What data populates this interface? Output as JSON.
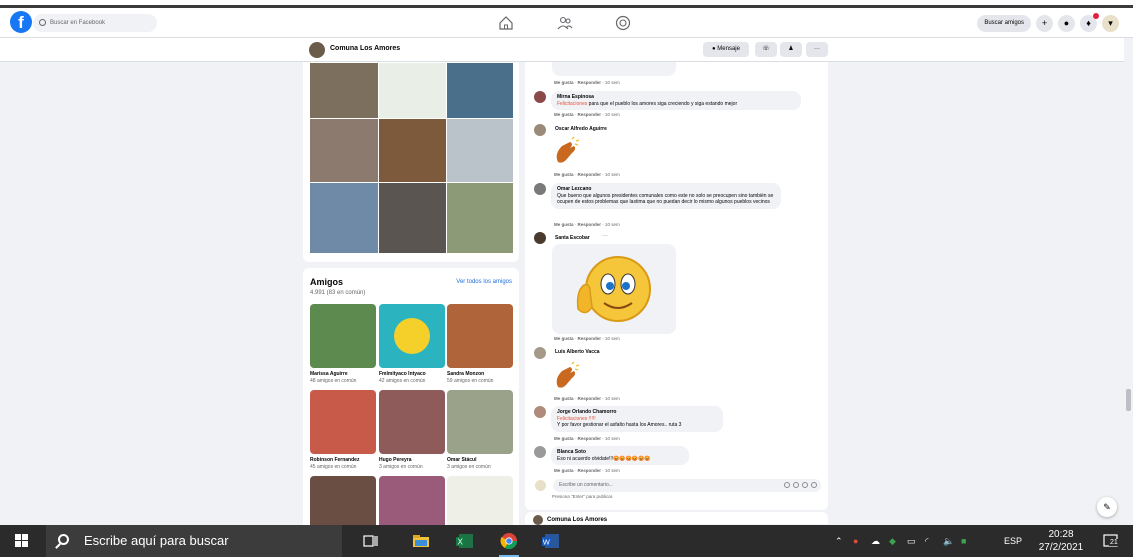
{
  "header": {
    "search_placeholder": "Buscar en Facebook",
    "find_friends": "Buscar amigos"
  },
  "page_bar": {
    "page_name": "Comuna Los Amores",
    "message_button": "Mensaje",
    "more_button": "···"
  },
  "friends": {
    "title": "Amigos",
    "count": "4.991 (83 en común)",
    "see_all": "Ver todos los amigos",
    "items": [
      {
        "name": "Marissa Aguirre",
        "mutual": "48 amigos en común"
      },
      {
        "name": "Fmlmityaco Intyaco",
        "mutual": "42 amigos en común"
      },
      {
        "name": "Sandra Monzon",
        "mutual": "59 amigos en común"
      },
      {
        "name": "Robinson Fernandez",
        "mutual": "45 amigos en común"
      },
      {
        "name": "Hugo Pereyra",
        "mutual": "3 amigos en común"
      },
      {
        "name": "Omar Stácul",
        "mutual": "3 amigos en común"
      }
    ]
  },
  "comments": {
    "like": "Me gusta",
    "reply": "Responder",
    "time": "10 sem",
    "items": [
      {
        "author": "Mirna Espinosa",
        "highlight": "Felicitaciones",
        "text": " para que el pueblo los amores siga creciendo y siga estando mejor"
      },
      {
        "author": "Oscar Alfredo Aguirre"
      },
      {
        "author": "Omar Lezcano",
        "text": "Que bueno que algunos presidentes comunales como este no solo se preocupen sino también se ocupen de estos problemas que lastima que no puedan decir lo mismo algunos pueblos vecinos"
      },
      {
        "author": "Santa Escobar",
        "dots": "···"
      },
      {
        "author": "Luis Alberto Vacca"
      },
      {
        "author": "Jorge Orlando Chamorro",
        "highlight": "Felicitaciones !!!!!",
        "text": "Y por favor gestionar el asfalto hasta los Amores.. ruta 3"
      },
      {
        "author": "Blanca Soto",
        "text": "Eso ni acuerdo olvidate!!!😡😡😡😡😡😡"
      }
    ],
    "input_placeholder": "Escribe un comentario...",
    "enter_hint": "Presiona \"Enter\" para publicar."
  },
  "next_post": {
    "author": "Comuna Los Amores"
  },
  "taskbar": {
    "search_placeholder": "Escribe aquí para buscar",
    "language": "ESP",
    "time": "20:28",
    "date": "27/2/2021",
    "notification_count": "21"
  },
  "colors": {
    "facebook_blue": "#1877f2",
    "highlight_orange": "#e4573d",
    "link_blue": "#216fdb",
    "taskbar": "#2b2b2b"
  }
}
